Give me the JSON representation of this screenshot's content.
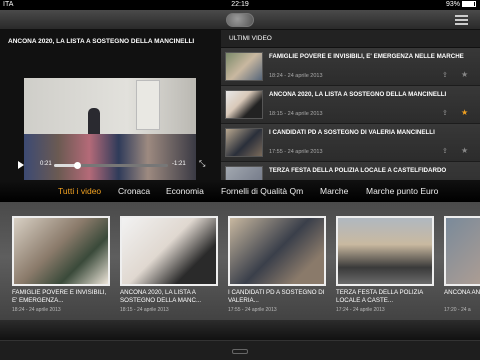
{
  "status_bar": {
    "carrier": "ITA",
    "time": "22:19",
    "battery": "93%"
  },
  "navbar": {
    "logo_icon": "app-logo-icon",
    "menu_icon": "hamburger-menu-icon"
  },
  "player": {
    "title": "ANCONA 2020, LA LISTA  A SOSTEGNO DELLA MANCINELLI",
    "elapsed": "0:21",
    "remaining": "-1:21",
    "progress": 0.2
  },
  "latest": {
    "header": "ULTIMI VIDEO",
    "items": [
      {
        "title": "FAMIGLIE POVERE E INVISIBILI, E' EMERGENZA NELLE MARCHE",
        "meta": "18:24 - 24 aprile 2013",
        "starred": false
      },
      {
        "title": "ANCONA 2020, LA LISTA  A SOSTEGNO DELLA MANCINELLI",
        "meta": "18:15 - 24 aprile 2013",
        "starred": true
      },
      {
        "title": "I CANDIDATI PD A SOSTEGNO DI VALERIA MANCINELLI",
        "meta": "17:55 - 24 aprile 2013",
        "starred": false
      },
      {
        "title": "TERZA FESTA DELLA POLIZIA LOCALE A CASTELFIDARDO",
        "meta": "",
        "starred": false
      }
    ]
  },
  "categories": [
    "Tutti i video",
    "Cronaca",
    "Economia",
    "Fornelli di Qualità Qm",
    "Marche",
    "Marche punto Euro"
  ],
  "active_category": 0,
  "shelf": [
    {
      "title": "FAMIGLIE POVERE E INVISIBILI, E' EMERGENZA...",
      "meta": "18:24 - 24 aprile 2013"
    },
    {
      "title": "ANCONA 2020, LA LISTA  A SOSTEGNO DELLA MANC...",
      "meta": "18:15 - 24 aprile 2013"
    },
    {
      "title": "I CANDIDATI PD A SOSTEGNO DI VALERIA...",
      "meta": "17:55 - 24 aprile 2013"
    },
    {
      "title": "TERZA FESTA DELLA POLIZIA LOCALE A CASTE...",
      "meta": "17:24 - 24 aprile 2013"
    },
    {
      "title": "ANCONA ANNI",
      "meta": "17:20 - 24 a"
    }
  ],
  "colors": {
    "accent": "#f0a020",
    "star_on": "#f0a020",
    "star_off": "#888888"
  }
}
